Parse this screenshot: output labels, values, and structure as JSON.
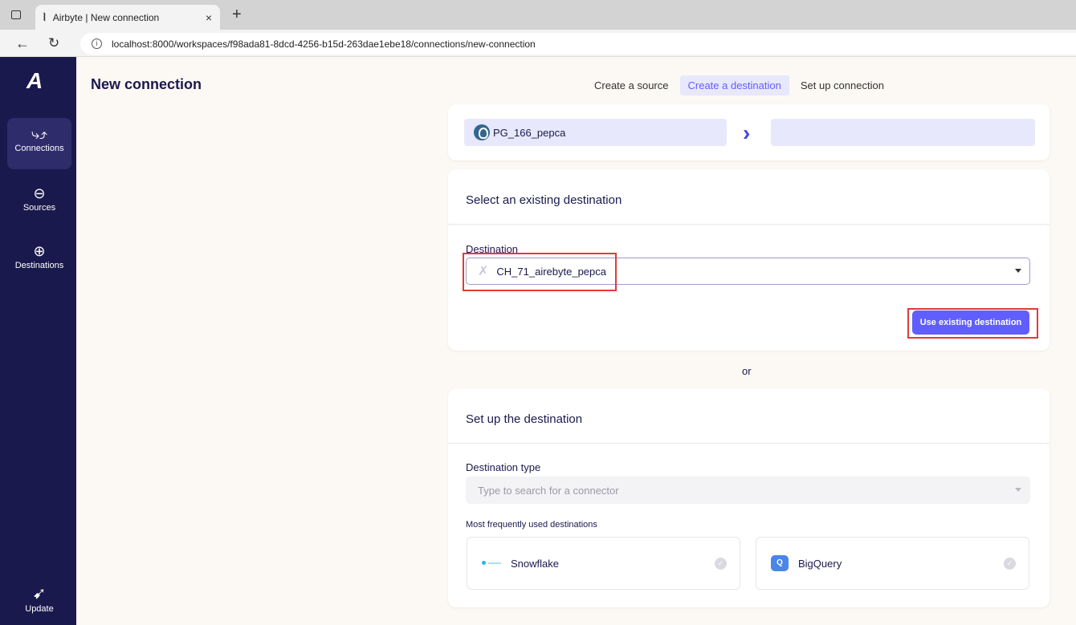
{
  "browser": {
    "tab_title": "Airbyte | New connection",
    "tab_close": "×",
    "new_tab": "+",
    "url_host": "localhost",
    "url_path": ":8000/workspaces/f98ada81-8dcd-4256-b15d-263dae1ebe18/connections/new-connection"
  },
  "sidebar": {
    "logo": "A",
    "items": [
      {
        "label": "Connections",
        "icon": "connections-icon",
        "glyph": "⤷⤴",
        "active": true
      },
      {
        "label": "Sources",
        "icon": "source-arrow-icon",
        "glyph": "⊖"
      },
      {
        "label": "Destinations",
        "icon": "destination-arrow-icon",
        "glyph": "⊕"
      }
    ],
    "update": {
      "label": "Update",
      "icon": "rocket-icon",
      "glyph": "➹"
    }
  },
  "page": {
    "title": "New connection"
  },
  "steps": [
    {
      "label": "Create a source"
    },
    {
      "label": "Create a destination",
      "active": true
    },
    {
      "label": "Set up connection"
    }
  ],
  "summary": {
    "source_name": "PG_166_pepca",
    "arrow": "›",
    "destination_name": ""
  },
  "existing": {
    "header": "Select an existing destination",
    "field_label": "Destination",
    "selected_value": "CH_71_airebyte_pepca",
    "button_label": "Use existing destination"
  },
  "separator": "or",
  "setup": {
    "header": "Set up the destination",
    "type_label": "Destination type",
    "type_placeholder": "Type to search for a connector",
    "frequent_label": "Most frequently used destinations",
    "frequent": [
      {
        "name": "Snowflake",
        "icon": "snowflake-icon"
      },
      {
        "name": "BigQuery",
        "icon": "bigquery-icon",
        "glyph": "Q"
      }
    ]
  },
  "colors": {
    "sidebar_bg": "#1a194d",
    "accent": "#615eff",
    "highlight": "#e23a3a",
    "page_bg": "#fcf8f4"
  }
}
